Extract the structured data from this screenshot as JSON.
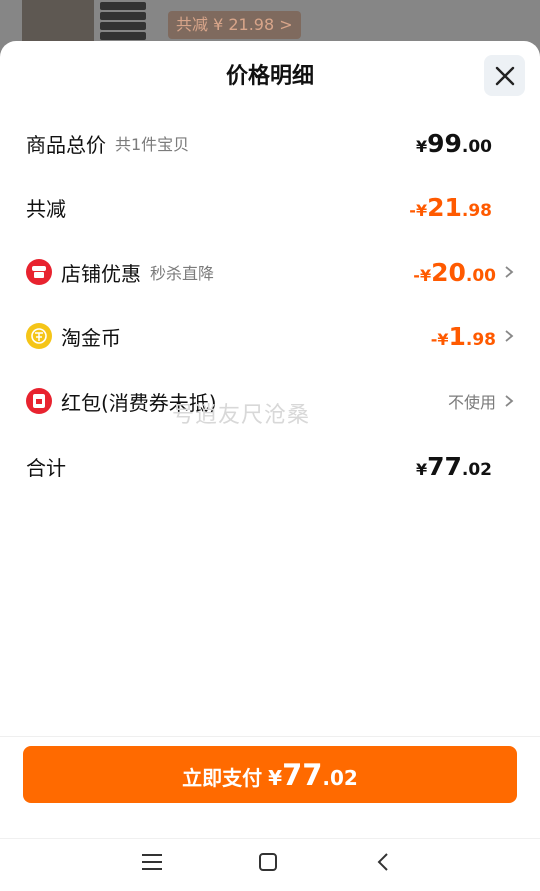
{
  "background": {
    "promo_text": "共减 ¥ 21.98 >"
  },
  "sheet": {
    "title": "价格明细",
    "rows": {
      "goods_total": {
        "label": "商品总价",
        "sub": "共1件宝贝",
        "currency": "¥",
        "int": "99",
        "dec": ".00"
      },
      "total_discount": {
        "label": "共减",
        "sign": "-¥",
        "int": "21",
        "dec": ".98"
      },
      "shop_discount": {
        "label": "店铺优惠",
        "sub": "秒杀直降",
        "sign": "-¥",
        "int": "20",
        "dec": ".00"
      },
      "gold_coin": {
        "label": "淘金币",
        "sign": "-¥",
        "int": "1",
        "dec": ".98"
      },
      "red_packet": {
        "label": "红包(消费券未抵)",
        "value": "不使用"
      },
      "sum": {
        "label": "合计",
        "currency": "¥",
        "int": "77",
        "dec": ".02"
      }
    },
    "watermark": "号逍友尺沧桑"
  },
  "pay_button": {
    "label": "立即支付",
    "currency": "¥",
    "int": "77",
    "dec": ".02"
  },
  "colors": {
    "accent": "#ff6a00",
    "discount": "#ff5a00",
    "shop_icon": "#e8232f",
    "coin_icon": "#f5c518"
  },
  "icons": [
    "close-icon",
    "shop-icon",
    "gold-coin-icon",
    "red-packet-icon",
    "chevron-right-icon",
    "menu-icon",
    "home-icon",
    "back-icon"
  ]
}
